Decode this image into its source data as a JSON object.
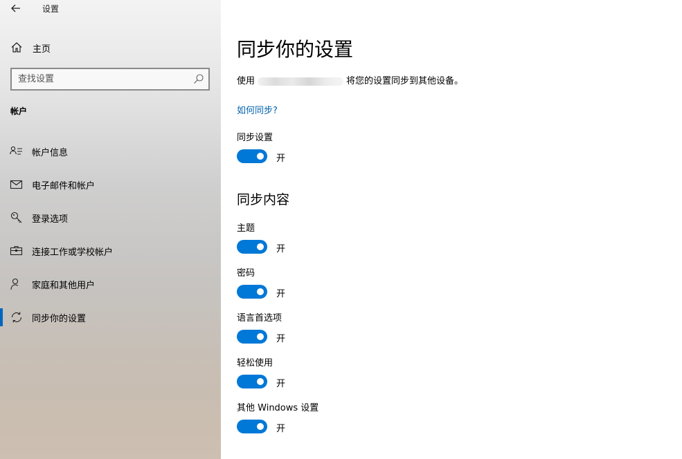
{
  "titlebar": {
    "title": "设置"
  },
  "sidebar": {
    "home_label": "主页",
    "search_placeholder": "查找设置",
    "section_title": "帐户",
    "items": [
      {
        "label": "帐户信息",
        "icon": "account-info-icon"
      },
      {
        "label": "电子邮件和帐户",
        "icon": "mail-icon"
      },
      {
        "label": "登录选项",
        "icon": "key-icon"
      },
      {
        "label": "连接工作或学校帐户",
        "icon": "briefcase-icon"
      },
      {
        "label": "家庭和其他用户",
        "icon": "person-add-icon"
      },
      {
        "label": "同步你的设置",
        "icon": "sync-icon",
        "active": true
      }
    ]
  },
  "main": {
    "title": "同步你的设置",
    "desc_prefix": "使用",
    "desc_suffix": "将您的设置同步到其他设备。",
    "how_link": "如何同步?",
    "sync_setting": {
      "label": "同步设置",
      "state": "开"
    },
    "content_title": "同步内容",
    "content_items": [
      {
        "label": "主题",
        "state": "开"
      },
      {
        "label": "密码",
        "state": "开"
      },
      {
        "label": "语言首选项",
        "state": "开"
      },
      {
        "label": "轻松使用",
        "state": "开"
      },
      {
        "label": "其他 Windows 设置",
        "state": "开"
      }
    ]
  },
  "colors": {
    "accent": "#0078d7",
    "link": "#0063b1"
  }
}
